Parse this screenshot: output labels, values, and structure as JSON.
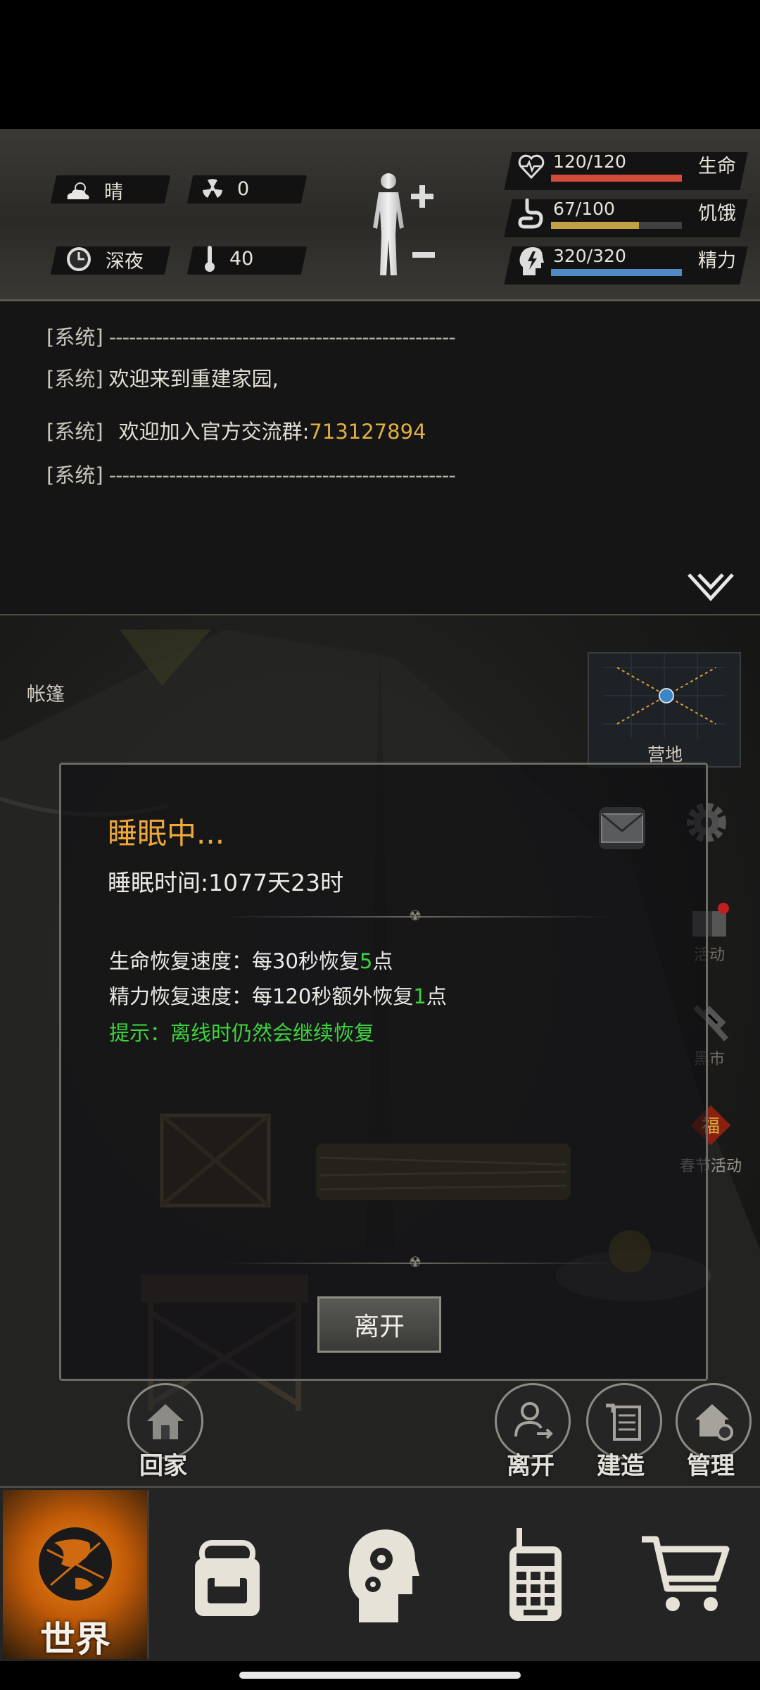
{
  "status": {
    "weather": "晴",
    "radiation": "0",
    "time_of_day": "深夜",
    "temperature": "40",
    "bars": [
      {
        "key": "health",
        "value": "120/120",
        "label": "生命",
        "fraction": 1.0,
        "color": "#d24a3a",
        "icon": "heart-pulse-icon"
      },
      {
        "key": "hunger",
        "value": "67/100",
        "label": "饥饿",
        "fraction": 0.67,
        "color": "#c2a145",
        "icon": "stomach-icon"
      },
      {
        "key": "energy",
        "value": "320/320",
        "label": "精力",
        "fraction": 1.0,
        "color": "#4f8ac4",
        "icon": "brain-bolt-icon"
      }
    ]
  },
  "log": {
    "tag": "[系统]",
    "dashes": "----------------------------------------------------",
    "welcome": "欢迎来到重建家园,",
    "group_text": "欢迎加入官方交流群:",
    "group_number": "713127894"
  },
  "scene": {
    "tent_label": "帐篷",
    "camp_label": "营地",
    "side_buttons": {
      "events": "活动",
      "black_market": "黑市",
      "spring_festival": "春节活动"
    },
    "round_buttons": {
      "home": "回家",
      "leave": "离开",
      "build": "建造",
      "manage": "管理"
    }
  },
  "dialog": {
    "title": "睡眠中...",
    "sleep_time": "睡眠时间:1077天23时",
    "health_prefix": "生命恢复速度：每30秒恢复",
    "health_value": "5",
    "health_suffix": "点",
    "energy_prefix": "精力恢复速度：每120秒额外恢复",
    "energy_value": "1",
    "energy_suffix": "点",
    "hint": "提示：离线时仍然会继续恢复",
    "leave_button": "离开"
  },
  "nav": {
    "world_label": "世界",
    "items": [
      "globe-icon",
      "backpack-icon",
      "brain-gears-icon",
      "radio-icon",
      "cart-icon"
    ]
  },
  "colors": {
    "title_orange": "#f0a83a",
    "green": "#3ed23e",
    "group_yellow": "#e0b040",
    "world_orange": "#e87a12"
  }
}
